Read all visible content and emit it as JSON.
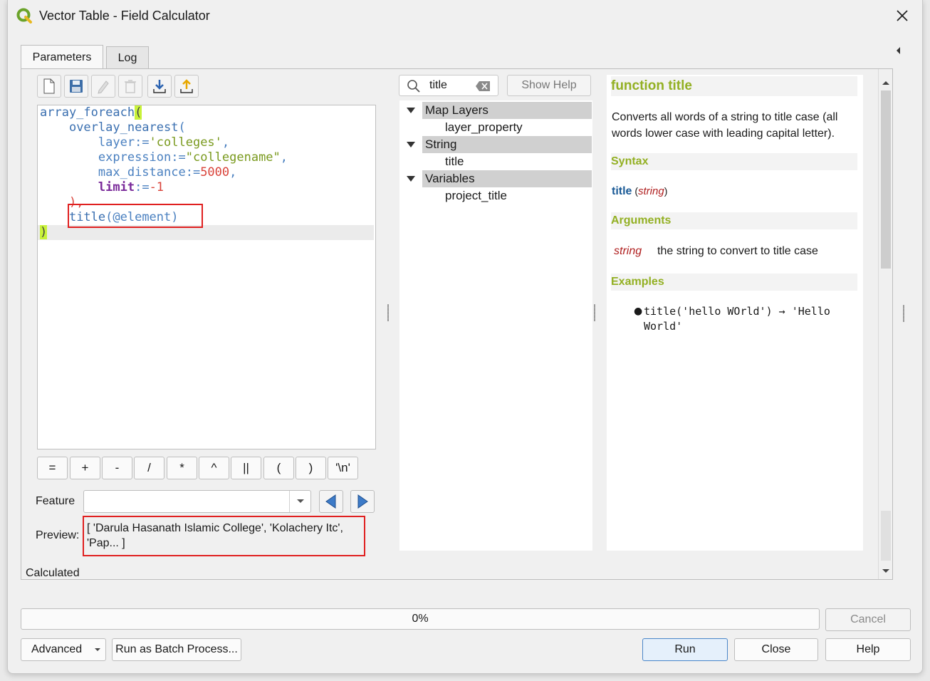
{
  "window": {
    "title": "Vector Table - Field Calculator"
  },
  "tabs": [
    {
      "label": "Parameters"
    },
    {
      "label": "Log"
    }
  ],
  "editor": {
    "lines": [
      "array_foreach(",
      "    overlay_nearest(",
      "        layer:='colleges',",
      "        expression:=\"collegename\",",
      "        max_distance:=5000,",
      "        limit:=-1",
      "    ),",
      "    title(@element)",
      ")"
    ],
    "highlighted_expression": "title(@element)"
  },
  "operators": [
    "=",
    "+",
    "-",
    "/",
    "*",
    "^",
    "||",
    "(",
    ")",
    "'\\n'"
  ],
  "feature": {
    "label": "Feature",
    "value": ""
  },
  "preview": {
    "label": "Preview:",
    "text": "[ 'Darula Hasanath Islamic College', 'Kolachery Itc', 'Pap... ]"
  },
  "status_text": "Calculated",
  "search": {
    "value": "title",
    "clear_icon": "backspace-clear-icon"
  },
  "show_help": "Show Help",
  "function_tree": [
    {
      "group": "Map Layers",
      "items": [
        "layer_property"
      ]
    },
    {
      "group": "String",
      "items": [
        "title"
      ]
    },
    {
      "group": "Variables",
      "items": [
        "project_title"
      ]
    }
  ],
  "help": {
    "heading": "function title",
    "description": "Converts all words of a string to title case (all words lower case with leading capital letter).",
    "syntax_heading": "Syntax",
    "syntax_name": "title",
    "syntax_arg": "string",
    "arguments_heading": "Arguments",
    "arg_name": "string",
    "arg_desc": "the string to convert to title case",
    "examples_heading": "Examples",
    "example_1": "title('hello WOrld') → 'Hello",
    "example_2": "World'"
  },
  "progress": {
    "text": "0%",
    "value": 0
  },
  "buttons": {
    "cancel": "Cancel",
    "advanced": "Advanced",
    "batch": "Run as Batch Process...",
    "run": "Run",
    "close": "Close",
    "help": "Help"
  },
  "colors": {
    "accent": "#93b023",
    "highlight_box": "#e02020",
    "bracket_match": "#c8f23a"
  }
}
